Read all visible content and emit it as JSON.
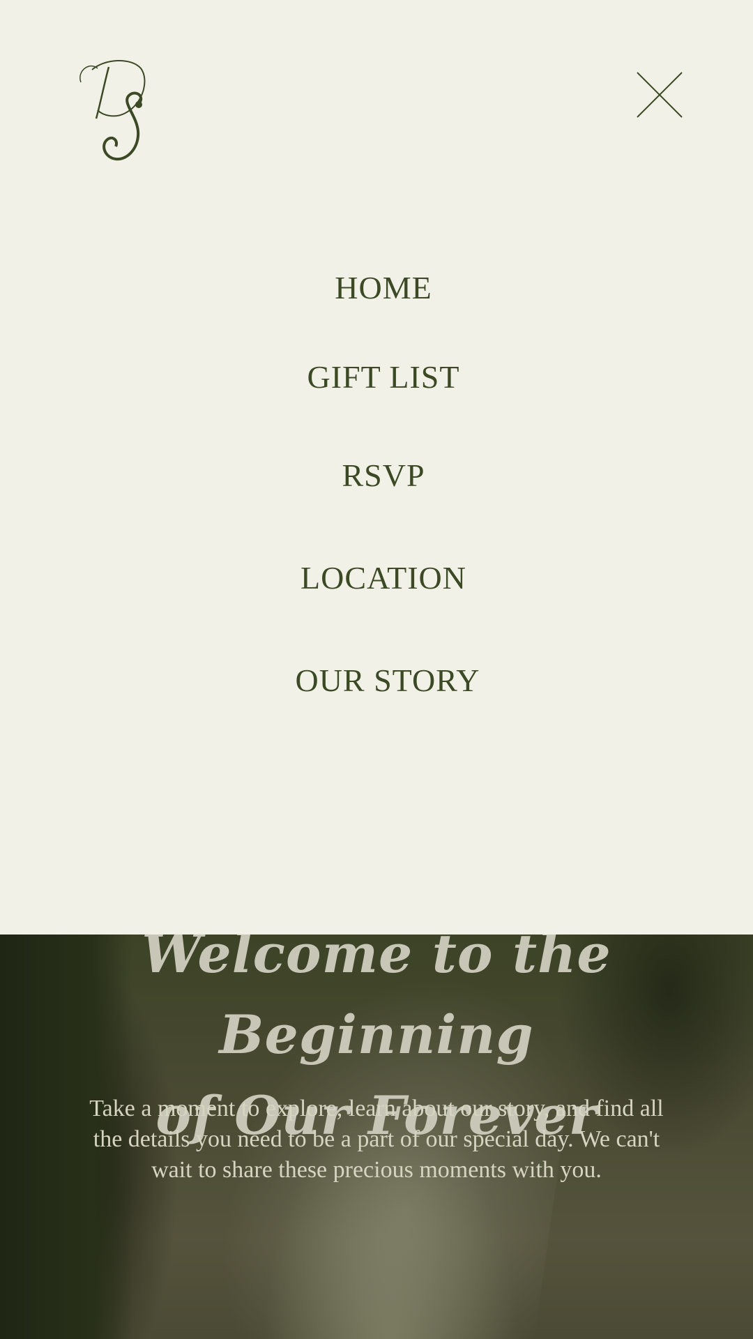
{
  "brand": {
    "monogram": "DS",
    "color": "#3b4a24"
  },
  "menu": {
    "background": "#f2f1e8",
    "close_icon": "close-icon",
    "items": [
      {
        "label": "HOME"
      },
      {
        "label": "GIFT LIST"
      },
      {
        "label": "RSVP"
      },
      {
        "label": "LOCATION"
      },
      {
        "label": "OUR STORY"
      }
    ]
  },
  "hero": {
    "title_line1": "Welcome to the Beginning",
    "title_line2": "of Our Forever",
    "text": "Take a moment to explore, learn about our story, and find all the details you need to be a part of our special day. We can't wait to share these precious moments with you."
  }
}
